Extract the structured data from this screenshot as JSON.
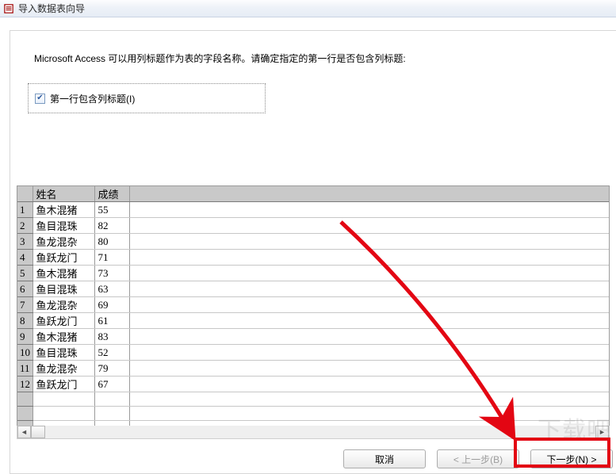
{
  "window": {
    "title": "导入数据表向导"
  },
  "instruction": "Microsoft Access 可以用列标题作为表的字段名称。请确定指定的第一行是否包含列标题:",
  "checkbox": {
    "label": "第一行包含列标题(I)",
    "checked": true
  },
  "grid": {
    "columns": [
      "姓名",
      "成绩"
    ],
    "rows": [
      {
        "n": "1",
        "name": "鱼木混猪",
        "score": "55"
      },
      {
        "n": "2",
        "name": "鱼目混珠",
        "score": "82"
      },
      {
        "n": "3",
        "name": "鱼龙混杂",
        "score": "80"
      },
      {
        "n": "4",
        "name": "鱼跃龙门",
        "score": "71"
      },
      {
        "n": "5",
        "name": "鱼木混猪",
        "score": "73"
      },
      {
        "n": "6",
        "name": "鱼目混珠",
        "score": "63"
      },
      {
        "n": "7",
        "name": "鱼龙混杂",
        "score": "69"
      },
      {
        "n": "8",
        "name": "鱼跃龙门",
        "score": "61"
      },
      {
        "n": "9",
        "name": "鱼木混猪",
        "score": "83"
      },
      {
        "n": "10",
        "name": "鱼目混珠",
        "score": "52"
      },
      {
        "n": "11",
        "name": "鱼龙混杂",
        "score": "79"
      },
      {
        "n": "12",
        "name": "鱼跃龙门",
        "score": "67"
      }
    ]
  },
  "buttons": {
    "cancel": "取消",
    "back": "< 上一步(B)",
    "next": "下一步(N) >"
  },
  "watermark": "下载吧"
}
